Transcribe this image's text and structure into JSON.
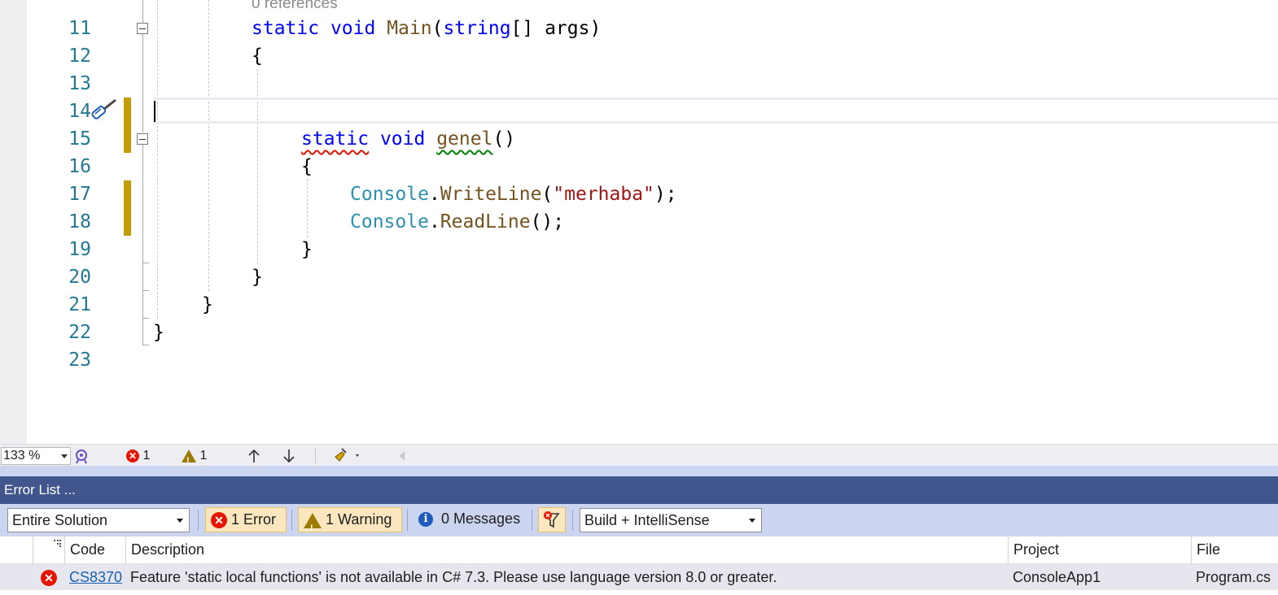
{
  "editor": {
    "references_label": "0 references",
    "lines": [
      {
        "num": "11"
      },
      {
        "num": "12"
      },
      {
        "num": "13"
      },
      {
        "num": "14"
      },
      {
        "num": "15"
      },
      {
        "num": "16"
      },
      {
        "num": "17"
      },
      {
        "num": "18"
      },
      {
        "num": "19"
      },
      {
        "num": "20"
      },
      {
        "num": "21"
      },
      {
        "num": "22"
      },
      {
        "num": "23"
      }
    ],
    "code": {
      "l11_static": "static",
      "l11_void": "void",
      "l11_main": "Main",
      "l11_paren_open": "(",
      "l11_string": "string",
      "l11_brackets": "[] args)",
      "l12": "{",
      "l15_static": "static",
      "l15_void": "void",
      "l15_genel": "genel",
      "l15_parens": "()",
      "l16": "{",
      "l17_console": "Console",
      "l17_dot": ".",
      "l17_method": "WriteLine",
      "l17_open": "(",
      "l17_str": "\"merhaba\"",
      "l17_close": ");",
      "l18_console": "Console",
      "l18_dot": ".",
      "l18_method": "ReadLine",
      "l18_rest": "();",
      "l19": "}",
      "l20": "}",
      "l21": "}",
      "l22": "}"
    }
  },
  "status_bar": {
    "zoom": "133 %",
    "error_count": "1",
    "warning_count": "1"
  },
  "error_list": {
    "title": "Error List ...",
    "scope": "Entire Solution",
    "errors_btn": "1 Error",
    "warnings_btn": "1 Warning",
    "messages_btn": "0 Messages",
    "source": "Build + IntelliSense",
    "columns": {
      "code": "Code",
      "description": "Description",
      "project": "Project",
      "file": "File"
    },
    "rows": [
      {
        "code": "CS8370",
        "description": "Feature 'static local functions' is not available in C# 7.3. Please use language version 8.0 or greater.",
        "project": "ConsoleApp1",
        "file": "Program.cs"
      }
    ]
  },
  "colors": {
    "keyword": "#0000ff",
    "method": "#74531f",
    "type": "#2b91af",
    "string": "#a31515",
    "line_number": "#237893",
    "change_marker": "#c29c00",
    "error_list_title": "#40568d",
    "error": "#e51400"
  }
}
